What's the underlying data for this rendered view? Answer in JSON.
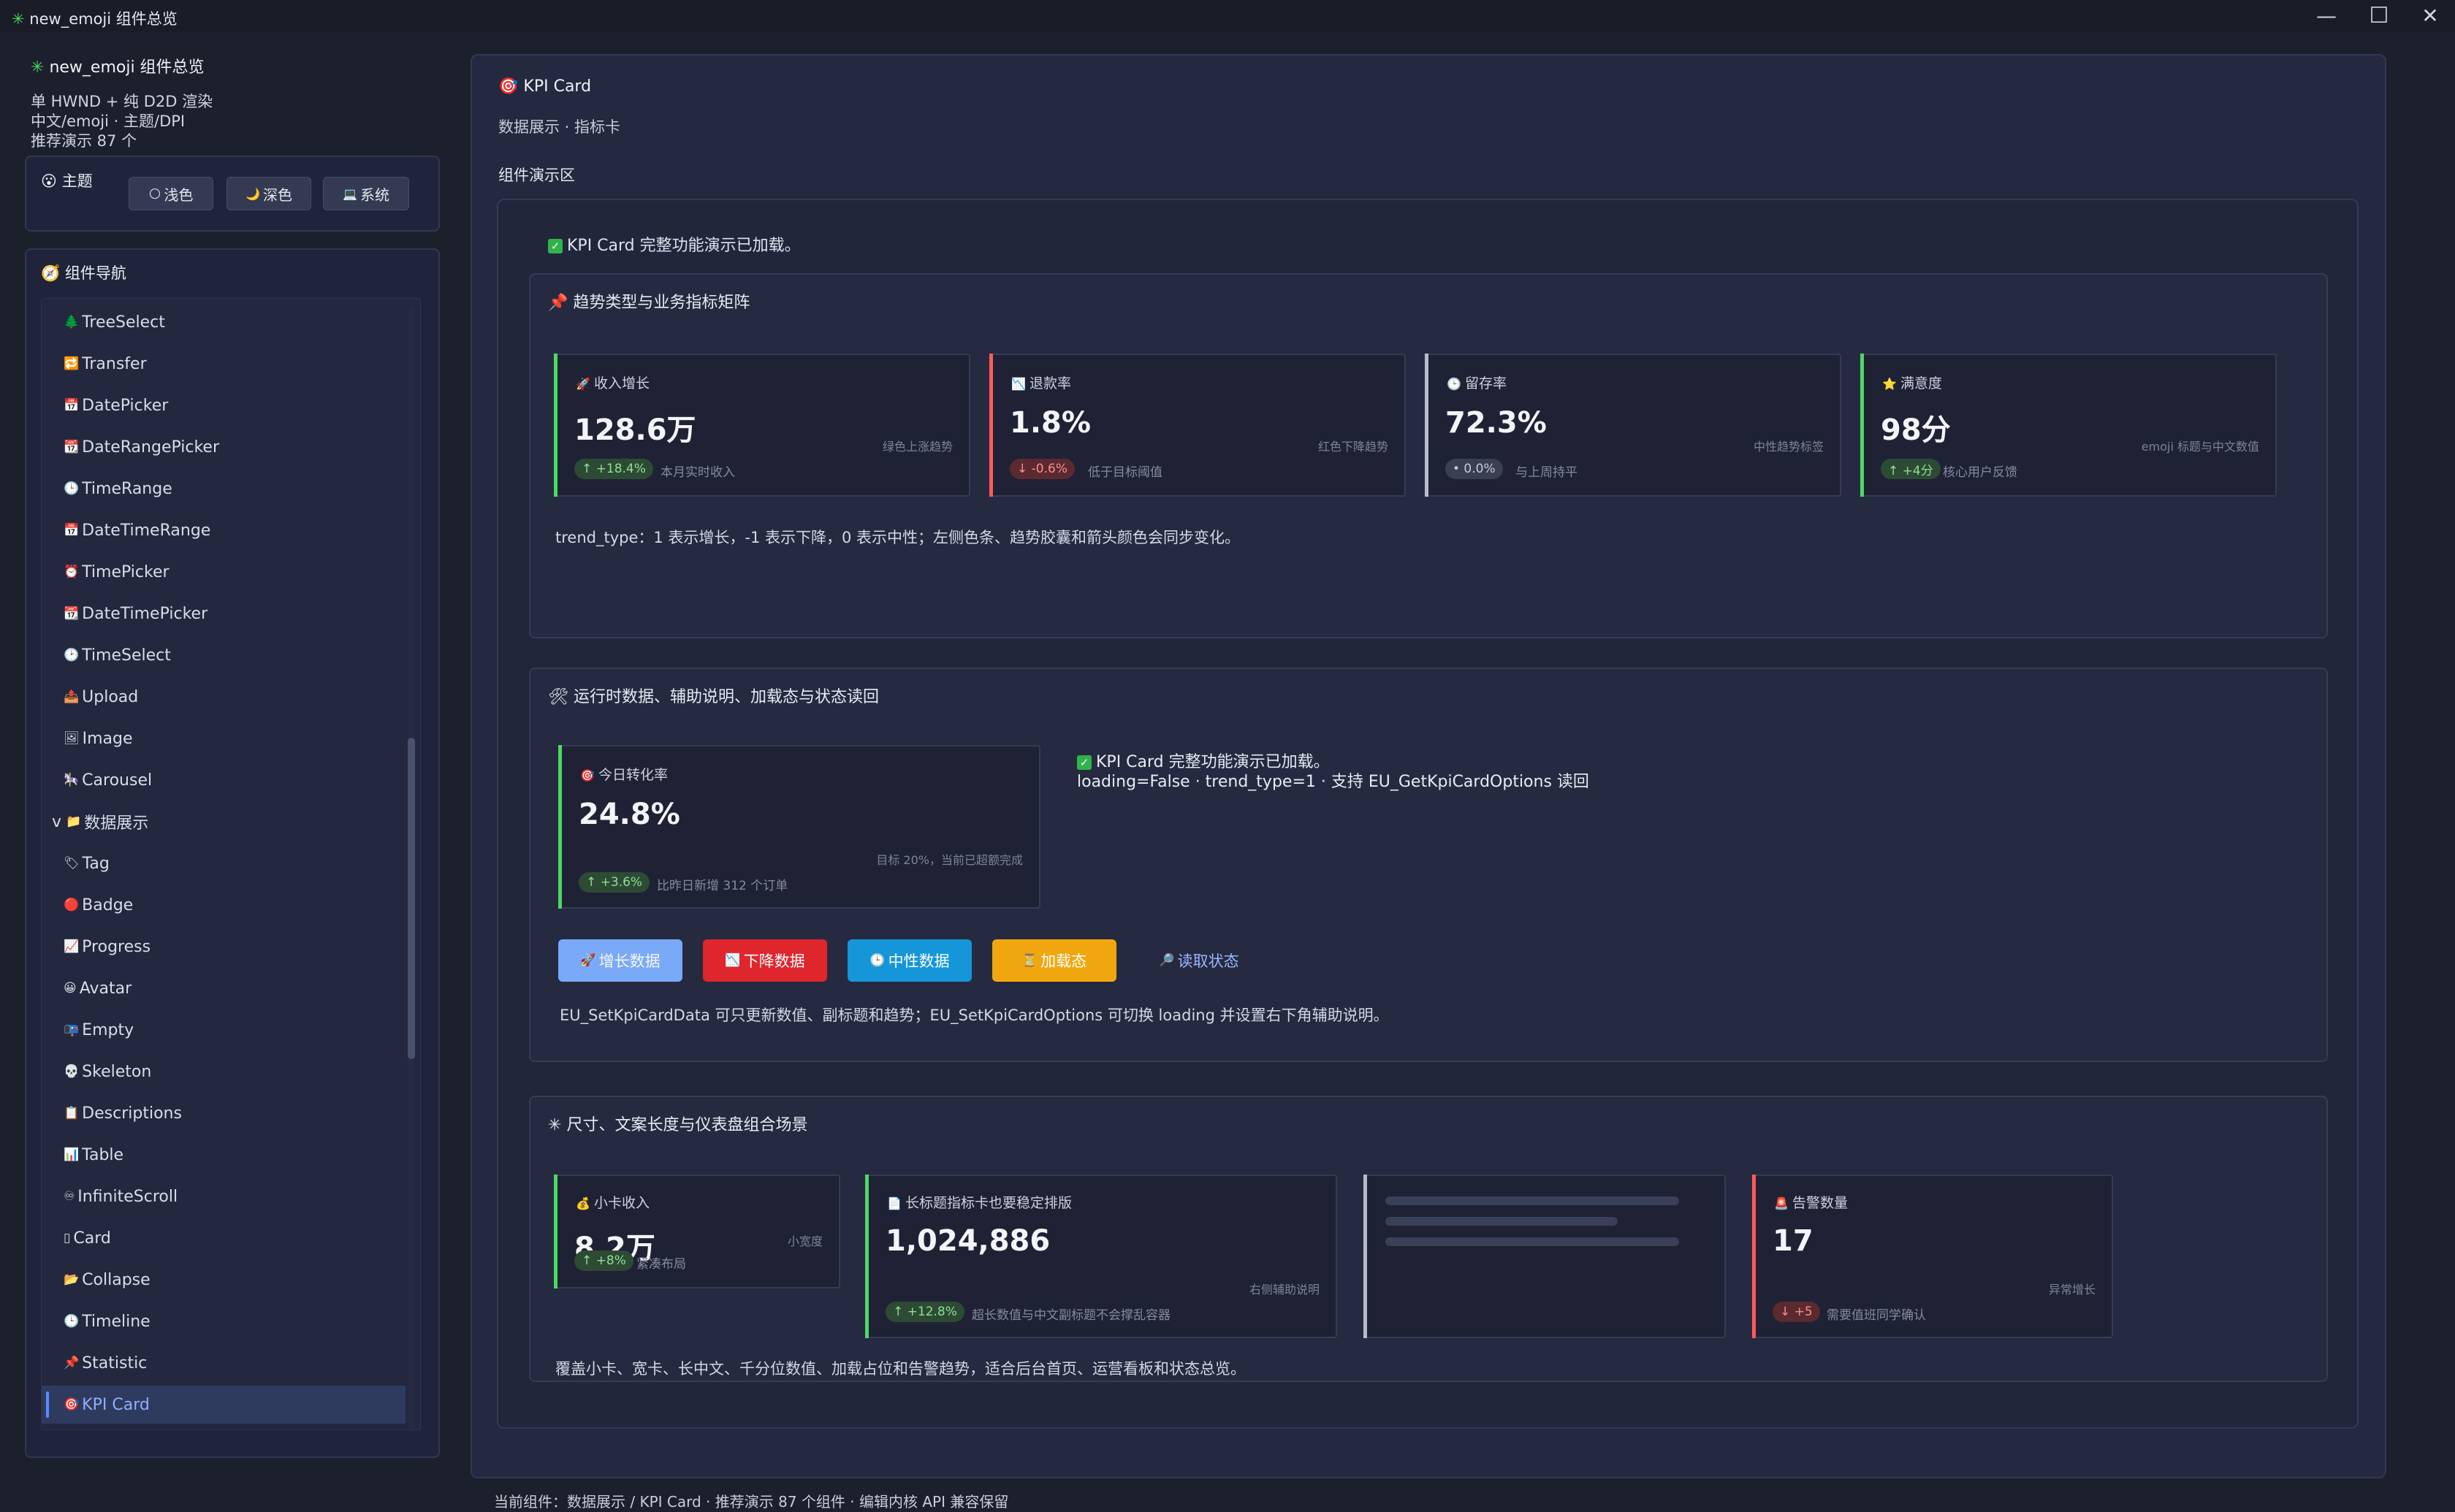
{
  "window": {
    "title": "new_emoji 组件总览",
    "title_icon": "✳",
    "controls": [
      "—",
      "☐",
      "✕"
    ]
  },
  "sidebar": {
    "app_title": "new_emoji 组件总览",
    "app_icon": "✳",
    "info_lines": [
      "单 HWND + 纯 D2D 渲染",
      "中文/emoji · 主题/DPI",
      "推荐演示 87 个"
    ],
    "theme_label": "主题",
    "theme_icon": "😮",
    "theme_buttons": [
      {
        "icon": "🌕",
        "label": "浅色"
      },
      {
        "icon": "🌙",
        "label": "深色"
      },
      {
        "icon": "💻",
        "label": "系统"
      }
    ],
    "nav_label": "组件导航",
    "nav_icon": "🧭",
    "nav_items": [
      {
        "icon": "🌲",
        "label": "TreeSelect"
      },
      {
        "icon": "🔁",
        "label": "Transfer"
      },
      {
        "icon": "📅",
        "label": "DatePicker"
      },
      {
        "icon": "📆",
        "label": "DateRangePicker"
      },
      {
        "icon": "🕒",
        "label": "TimeRange"
      },
      {
        "icon": "📅",
        "label": "DateTimeRange"
      },
      {
        "icon": "⏰",
        "label": "TimePicker"
      },
      {
        "icon": "📆",
        "label": "DateTimePicker"
      },
      {
        "icon": "🕑",
        "label": "TimeSelect"
      },
      {
        "icon": "📤",
        "label": "Upload"
      },
      {
        "icon": "🖼",
        "label": "Image"
      },
      {
        "icon": "🎠",
        "label": "Carousel"
      },
      {
        "icon": "📁",
        "label": "数据展示",
        "category": true,
        "prefix": "v"
      },
      {
        "icon": "🏷",
        "label": "Tag"
      },
      {
        "icon": "🔴",
        "label": "Badge"
      },
      {
        "icon": "📈",
        "label": "Progress"
      },
      {
        "icon": "😀",
        "label": "Avatar"
      },
      {
        "icon": "📭",
        "label": "Empty"
      },
      {
        "icon": "💀",
        "label": "Skeleton"
      },
      {
        "icon": "📋",
        "label": "Descriptions"
      },
      {
        "icon": "📊",
        "label": "Table"
      },
      {
        "icon": "♾",
        "label": "InfiniteScroll"
      },
      {
        "icon": "▯",
        "label": "Card"
      },
      {
        "icon": "📂",
        "label": "Collapse"
      },
      {
        "icon": "🕒",
        "label": "Timeline"
      },
      {
        "icon": "📌",
        "label": "Statistic"
      },
      {
        "icon": "🎯",
        "label": "KPI Card",
        "selected": true
      }
    ]
  },
  "main": {
    "title_icon": "🎯",
    "title": "KPI Card",
    "subtitle": "数据展示 · 指标卡",
    "demo_label": "组件演示区",
    "loaded_text": "KPI Card 完整功能演示已加载。",
    "sections": [
      {
        "icon": "📌",
        "title": "趋势类型与业务指标矩阵",
        "cards": [
          {
            "icon": "🚀",
            "title": "收入增长",
            "value": "128.6万",
            "hint": "绿色上涨趋势",
            "pill": "↑ +18.4%",
            "desc": "本月实时收入",
            "trend": "up",
            "color": "#4cd964"
          },
          {
            "icon": "📉",
            "title": "退款率",
            "value": "1.8%",
            "hint": "红色下降趋势",
            "pill": "↓ -0.6%",
            "desc": "低于目标阈值",
            "trend": "down",
            "color": "#ff5a5a"
          },
          {
            "icon": "🕒",
            "title": "留存率",
            "value": "72.3%",
            "hint": "中性趋势标签",
            "pill": "• 0.0%",
            "desc": "与上周持平",
            "trend": "flat",
            "color": "#b7bccb"
          },
          {
            "icon": "⭐",
            "title": "满意度",
            "value": "98分",
            "hint": "emoji 标题与中文数值",
            "pill": "↑ +4分",
            "desc": "核心用户反馈",
            "trend": "up",
            "color": "#4cd964"
          }
        ],
        "note": "trend_type：1 表示增长，-1 表示下降，0 表示中性；左侧色条、趋势胶囊和箭头颜色会同步变化。"
      },
      {
        "icon": "🛠",
        "title": "运行时数据、辅助说明、加载态与状态读回",
        "card": {
          "icon": "🎯",
          "title": "今日转化率",
          "value": "24.8%",
          "hint": "目标 20%，当前已超额完成",
          "pill": "↑ +3.6%",
          "desc": "比昨日新增 312 个订单",
          "trend": "up",
          "color": "#4cd964"
        },
        "status_line1": "KPI Card 完整功能演示已加载。",
        "status_line2": "loading=False · trend_type=1 · 支持 EU_GetKpiCardOptions 读回",
        "buttons": [
          {
            "icon": "🚀",
            "label": "增长数据",
            "color": "#7aa9f7"
          },
          {
            "icon": "📉",
            "label": "下降数据",
            "color": "#e0262d"
          },
          {
            "icon": "🕒",
            "label": "中性数据",
            "color": "#1596d8"
          },
          {
            "icon": "⏳",
            "label": "加载态",
            "color": "#f0a70f"
          },
          {
            "icon": "🔎",
            "label": "读取状态",
            "color": "transparent"
          }
        ],
        "note": "EU_SetKpiCardData 可只更新数值、副标题和趋势；EU_SetKpiCardOptions 可切换 loading 并设置右下角辅助说明。"
      },
      {
        "icon": "✳",
        "title": "尺寸、文案长度与仪表盘组合场景",
        "cards": [
          {
            "icon": "💰",
            "title": "小卡收入",
            "value": "8.2万",
            "hint": "小宽度",
            "pill": "↑ +8%",
            "desc": "紧凑布局",
            "trend": "up",
            "color": "#4cd964"
          },
          {
            "icon": "📄",
            "title": "长标题指标卡也要稳定排版",
            "value": "1,024,886",
            "hint": "右侧辅助说明",
            "pill": "↑ +12.8%",
            "desc": "超长数值与中文副标题不会撑乱容器",
            "trend": "up",
            "color": "#4cd964"
          },
          {
            "loading": true,
            "color": "#b7bccb"
          },
          {
            "icon": "🚨",
            "title": "告警数量",
            "value": "17",
            "hint": "异常增长",
            "pill": "↓ +5",
            "desc": "需要值班同学确认",
            "trend": "down",
            "color": "#ff5a5a"
          }
        ],
        "note": "覆盖小卡、宽卡、长中文、千分位数值、加载占位和告警趋势，适合后台首页、运营看板和状态总览。"
      }
    ]
  },
  "status_bar": "当前组件：数据展示 / KPI Card · 推荐演示 87 个组件 · 编辑内核 API 兼容保留"
}
